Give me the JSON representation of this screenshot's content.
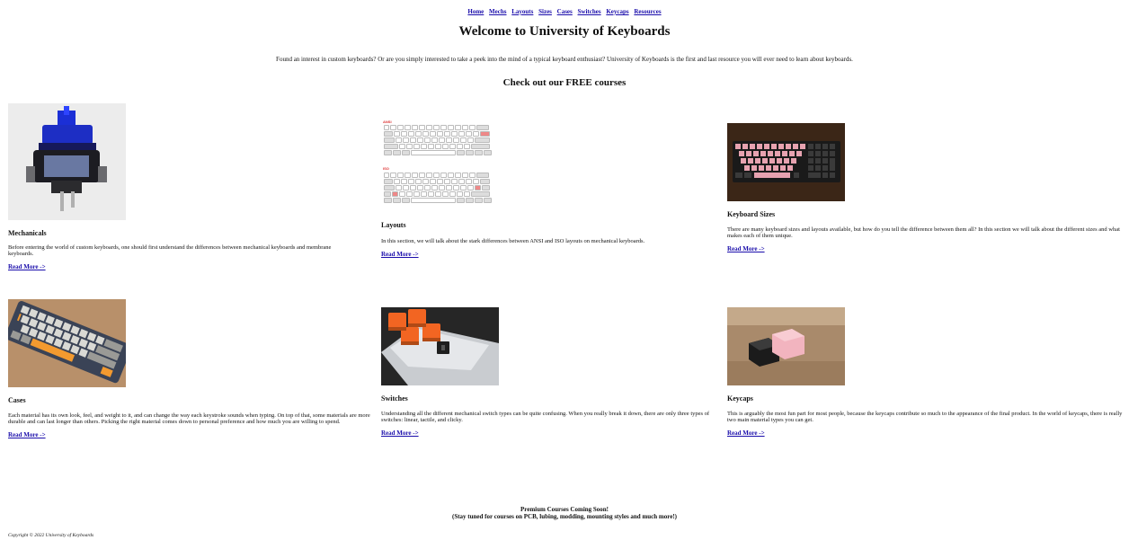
{
  "nav": {
    "items": [
      "Home",
      "Mechs",
      "Layouts",
      "Sizes",
      "Cases",
      "Switches",
      "Keycaps",
      "Resources"
    ]
  },
  "header": {
    "title": "Welcome to University of Keyboards",
    "intro": "Found an interest in custom keyboards? Or are you simply interested to take a peek into the mind of a typical keyboard enthusiast? University of Keyboards is the first and last resource you will ever need to learn about keyboards."
  },
  "courses_heading": "Check out our FREE courses",
  "courses": [
    {
      "title": "Mechanicals",
      "description": "Before entering the world of custom keyboards, one should first understand the differences between mechanical keyboards and membrane keyboards.",
      "link": "Read More ->",
      "image_icon": "switch-photo"
    },
    {
      "title": "Layouts",
      "description": "In this section, we will talk about the stark differences between ANSI and ISO layouts on mechanical keyboards.",
      "link": "Read More ->",
      "image_icon": "layout-diagram",
      "diagram_labels": [
        "ANSI",
        "ISO"
      ]
    },
    {
      "title": "Keyboard Sizes",
      "description": "There are many keyboard sizes and layouts available, but how do you tell the difference between them all? In this section we will talk about the different sizes and what makes each of them unique.",
      "link": "Read More ->",
      "image_icon": "keyboard-photo"
    },
    {
      "title": "Cases",
      "description": "Each material has its own look, feel, and weight to it, and can change the way each keystroke sounds when typing. On top of that, some materials are more durable and can last longer than others. Picking the right material comes down to personal preference and how much you are willing to spend.",
      "link": "Read More ->",
      "image_icon": "case-photo"
    },
    {
      "title": "Switches",
      "description": "Understanding all the different mechanical switch types can be quite confusing. When you really break it down, there are only three types of switches: linear, tactile, and clicky.",
      "link": "Read More ->",
      "image_icon": "switches-photo"
    },
    {
      "title": "Keycaps",
      "description": "This is arguably the most fun part for most people, because the keycaps contribute so much to the appearance of the final product. In the world of keycaps, there is really two main material types you can get.",
      "link": "Read More ->",
      "image_icon": "keycaps-photo"
    }
  ],
  "footer": {
    "premium_title": "Premium Courses Coming Soon!",
    "premium_sub": "(Stay tuned for courses on PCB, lubing, modding, mounting styles and much more!)",
    "copyright": "Copyright © 2022 University of Keyboards"
  }
}
